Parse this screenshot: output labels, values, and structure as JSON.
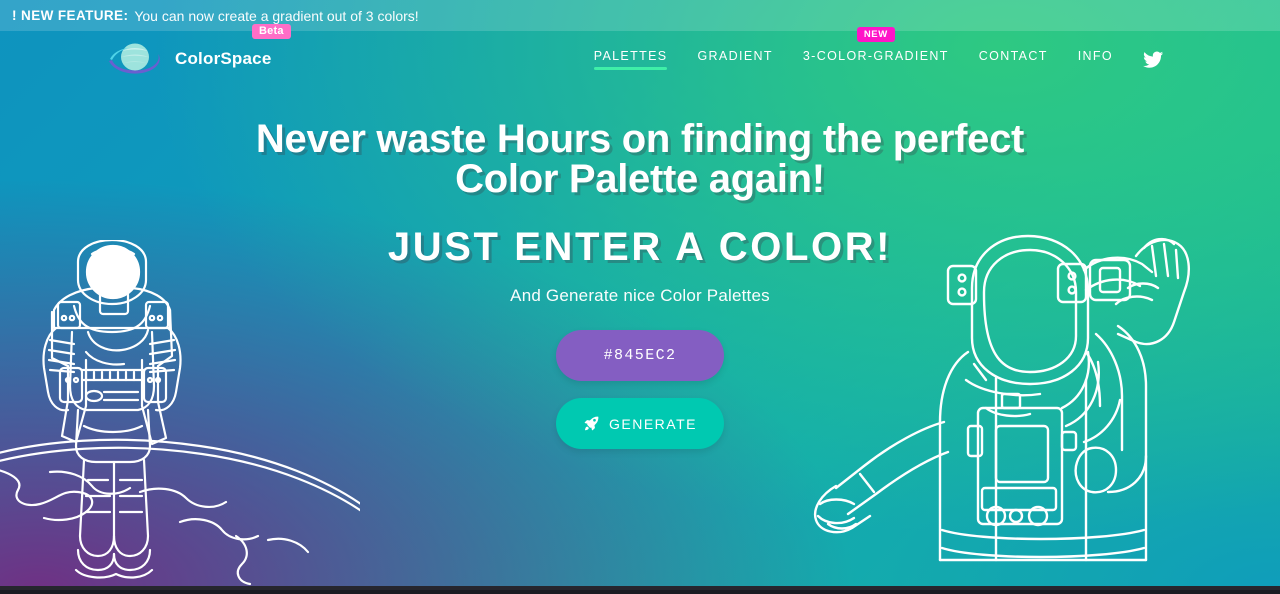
{
  "banner": {
    "label": "! NEW FEATURE:",
    "message": "You can now create a gradient out of 3 colors!"
  },
  "header": {
    "brand_name": "ColorSpace",
    "beta_badge": "Beta",
    "logo_icon": "planet-icon",
    "nav": [
      {
        "label": "PALETTES",
        "active": true,
        "badge": ""
      },
      {
        "label": "GRADIENT",
        "active": false,
        "badge": ""
      },
      {
        "label": "3-COLOR-GRADIENT",
        "active": false,
        "badge": "NEW"
      },
      {
        "label": "CONTACT",
        "active": false,
        "badge": ""
      },
      {
        "label": "INFO",
        "active": false,
        "badge": ""
      }
    ],
    "social_icon": "twitter-icon"
  },
  "hero": {
    "headline": "Never waste Hours on finding the perfect Color Palette again!",
    "subheadline": "JUST ENTER A COLOR!",
    "tagline": "And Generate nice Color Palettes",
    "color_value": "#845EC2",
    "color_placeholder": "#845EC2",
    "generate_label": "GENERATE",
    "generate_icon": "rocket-icon"
  },
  "colors": {
    "input_purple": "#845EC2",
    "generate_teal": "#00C9B1",
    "accent_underline": "#3FEFA8",
    "new_badge_pink": "#FF14C8",
    "beta_badge_pink": "#FF6EC7",
    "gradient_from": "#0E93BF",
    "gradient_to": "#22C582",
    "gradient_purple": "#6F3184"
  },
  "illustrations": {
    "left": "astronaut-on-planet-illustration",
    "right": "astronaut-waving-illustration"
  }
}
